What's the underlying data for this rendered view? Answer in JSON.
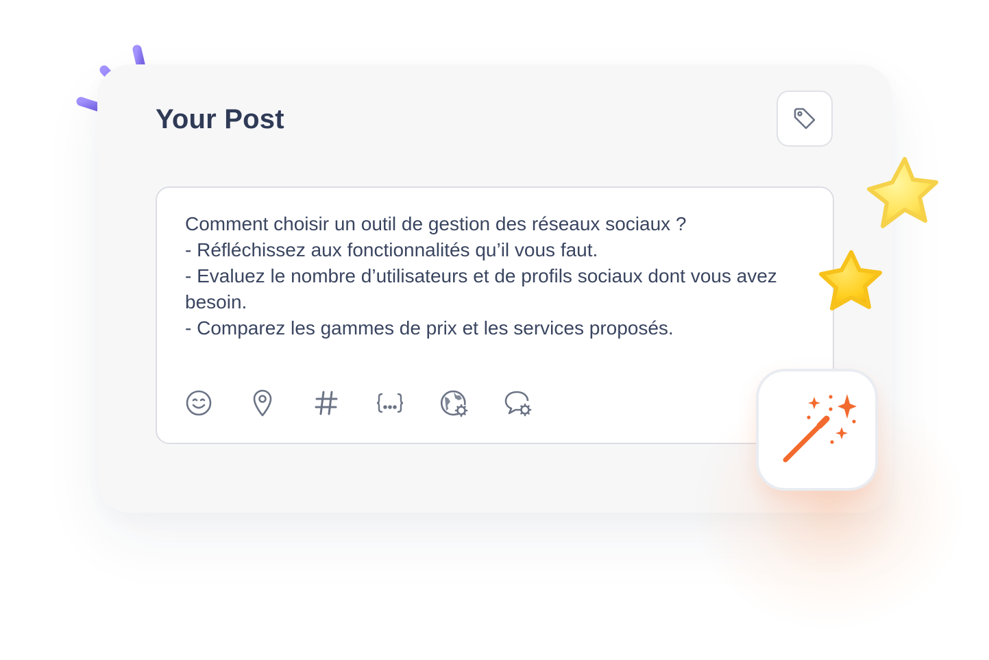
{
  "header": {
    "title": "Your Post"
  },
  "buttons": {
    "tag_icon": "tag-icon",
    "magic_icon": "magic-wand-icon"
  },
  "editor": {
    "text": "Comment choisir un outil de gestion des réseaux sociaux ?\n- Réfléchissez aux fonctionnalités qu’il vous faut.\n- Evaluez le nombre d’utilisateurs et de profils sociaux dont vous avez besoin.\n- Comparez les gammes de prix et les services proposés."
  },
  "toolbar": {
    "icons": [
      "emoji-icon",
      "location-pin-icon",
      "hashtag-icon",
      "variables-icon",
      "globe-settings-icon",
      "comment-settings-icon"
    ],
    "variables_glyph": "{...}",
    "hashtag_glyph": "#"
  },
  "colors": {
    "title": "#2f3a56",
    "text": "#3a4560",
    "icon": "#6b7385",
    "accent_orange": "#f26a2e",
    "accent_purple": "#8b7cf0",
    "star_yellow": "#ffd43a"
  }
}
